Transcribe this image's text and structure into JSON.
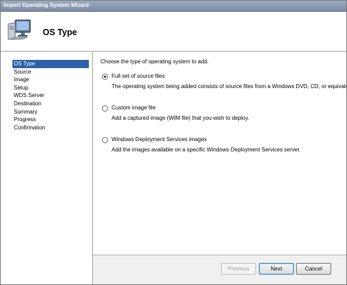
{
  "window": {
    "title": "Import Operating System Wizard"
  },
  "header": {
    "title": "OS Type",
    "icon": "computer-monitor-icon"
  },
  "sidebar": {
    "steps": [
      {
        "label": "OS Type",
        "active": true
      },
      {
        "label": "Source"
      },
      {
        "label": "Image"
      },
      {
        "label": "Setup"
      },
      {
        "label": "WDS Server"
      },
      {
        "label": "Destination"
      },
      {
        "label": "Summary"
      },
      {
        "label": "Progress"
      },
      {
        "label": "Confirmation"
      }
    ]
  },
  "content": {
    "intro": "Choose the type of operating system to add.",
    "options": [
      {
        "label": "Full set of source files",
        "description": "The operating system being added consists of source files from a Windows DVD, CD, or equivalent.",
        "selected": true
      },
      {
        "label": "Custom image file",
        "description": "Add a captured image (WIM file) that you wish to deploy.",
        "selected": false
      },
      {
        "label": "Windows Deployment Services images",
        "description": "Add the images available on a specific Windows Deployment Services server.",
        "selected": false
      }
    ]
  },
  "footer": {
    "previous_label": "Previous",
    "next_label": "Next",
    "cancel_label": "Cancel"
  },
  "colors": {
    "selection": "#2e61a8",
    "titlebar": "#8a9ab2"
  }
}
